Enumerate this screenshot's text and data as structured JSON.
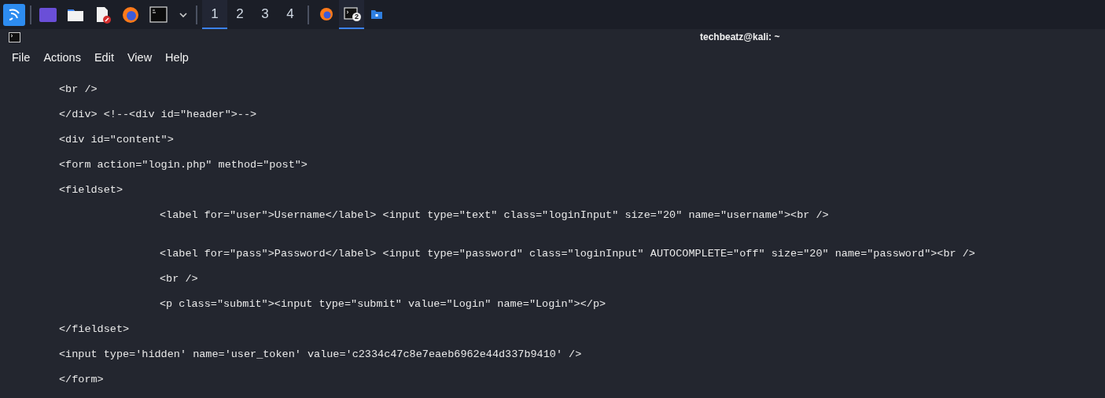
{
  "taskbar": {
    "workspaces": [
      {
        "label": "1",
        "selected": true
      },
      {
        "label": "2",
        "selected": false
      },
      {
        "label": "3",
        "selected": false
      },
      {
        "label": "4",
        "selected": false
      }
    ],
    "tasks": [
      {
        "kind": "browser",
        "selected": false
      },
      {
        "kind": "terminal",
        "selected": true,
        "badge": "2"
      },
      {
        "kind": "folder",
        "selected": false
      }
    ]
  },
  "window": {
    "title": "techbeatz@kali: ~",
    "menu": [
      "File",
      "Actions",
      "Edit",
      "View",
      "Help"
    ],
    "code": [
      {
        "text": "<br />"
      },
      {
        "text": "</div> <!--<div id=\"header\">-->"
      },
      {
        "text": "<div id=\"content\">"
      },
      {
        "text": "<form action=\"login.php\" method=\"post\">"
      },
      {
        "text": "<fieldset>",
        "children": [
          {
            "text": "<label for=\"user\">Username</label> <input type=\"text\" class=\"loginInput\" size=\"20\" name=\"username\"><br />"
          },
          {
            "text": "<label for=\"pass\">Password</label> <input type=\"password\" class=\"loginInput\" AUTOCOMPLETE=\"off\" size=\"20\" name=\"password\"><br />"
          },
          {
            "text": "<br />"
          },
          {
            "text": "<p class=\"submit\"><input type=\"submit\" value=\"Login\" name=\"Login\"></p>"
          }
        ]
      },
      {
        "text": "</fieldset>"
      },
      {
        "text": "<input type='hidden' name='user_token' value='c2334c47c8e7eaeb6962e44d337b9410' />"
      },
      {
        "text": "</form>"
      }
    ]
  }
}
